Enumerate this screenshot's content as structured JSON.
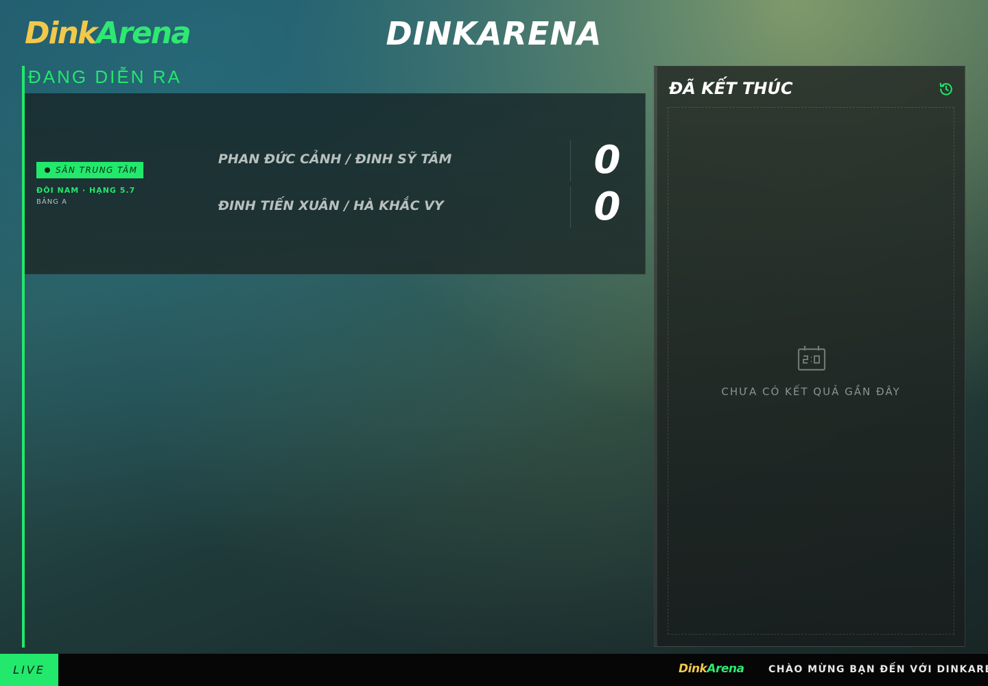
{
  "header": {
    "logo_part1": "Dink",
    "logo_part2": "Arena",
    "title": "DINKARENA"
  },
  "live": {
    "section_title": "ĐANG DIỄN RA",
    "match": {
      "court": "SÂN TRUNG TÂM",
      "category": "ĐÔI NAM · HẠNG 5.7",
      "group": "BẢNG A",
      "team1": "PHAN ĐỨC CẢNH / ĐINH SỸ TÂM",
      "team2": "ĐINH TIẾN XUÂN / HÀ KHẮC VY",
      "score1": "0",
      "score2": "0"
    }
  },
  "finished": {
    "title": "ĐÃ KẾT THÚC",
    "empty_text": "CHƯA CÓ KẾT QUẢ GẦN ĐÂY",
    "icons": {
      "history": "history-icon",
      "empty": "scoreboard-icon"
    }
  },
  "ticker": {
    "live_label": "LIVE",
    "logo_part1": "Dink",
    "logo_part2": "Arena",
    "message": "CHÀO MỪNG BẠN ĐẾN VỚI DINKARENA"
  },
  "colors": {
    "accent_green": "#22e86c",
    "logo_yellow": "#f2c84b"
  }
}
